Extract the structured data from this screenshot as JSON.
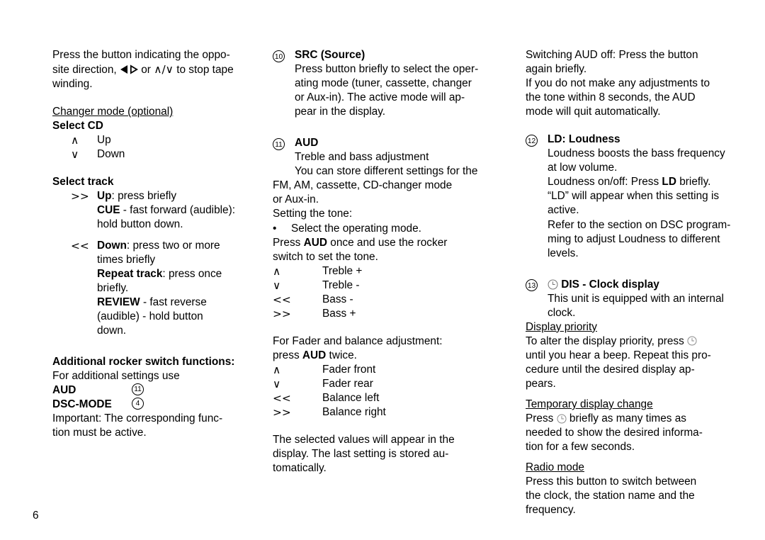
{
  "page": {
    "number": "6",
    "colors": {
      "text": "#000000",
      "background": "#ffffff"
    }
  },
  "icons": {
    "rocker_left_right": "rocker-left-right-icon",
    "arrow_up": "∧",
    "arrow_down": "∨",
    "arrow_back": "<<",
    "arrow_forward": ">>",
    "slash": "/",
    "clock": "clock-icon"
  },
  "left_column": {
    "intro": {
      "part1": "Press the button indicating the oppo-",
      "part2": "site direction, ",
      "part3": " or ",
      "part4": " to stop tape",
      "part5": "winding."
    },
    "changer_heading": "Changer mode (optional)",
    "select_cd": {
      "title": "Select CD",
      "rows": [
        {
          "key": "∧",
          "desc": "Up"
        },
        {
          "key": "∨",
          "desc": "Down"
        }
      ]
    },
    "select_track": {
      "title": "Select track",
      "row1": {
        "key": ">>",
        "line1_bold": "Up",
        "line1_rest": ": press briefly",
        "line2_bold": "CUE",
        "line2_rest": " - fast forward (audible):",
        "line3": "hold button down."
      },
      "row2": {
        "key": "<<",
        "line1_bold": "Down",
        "line1_rest": ": press two or more",
        "line2": "times briefly",
        "line3_bold": "Repeat track",
        "line3_rest": ": press once",
        "line4": "briefly.",
        "line5_bold": "REVIEW",
        "line5_rest": " - fast reverse",
        "line6": "(audible) - hold button",
        "line7": "down."
      }
    },
    "additional": {
      "title": "Additional rocker switch functions:",
      "intro": "For additional settings use",
      "items": [
        {
          "label": "AUD",
          "ref": "11"
        },
        {
          "label": "DSC-MODE",
          "ref": "4"
        }
      ],
      "note_line1": "Important:  The corresponding func-",
      "note_line2": "tion must be active."
    }
  },
  "middle_column": {
    "src": {
      "num": "10",
      "title": "SRC (Source)",
      "body_line1": "Press button briefly to select the oper-",
      "body_line2": "ating mode (tuner, cassette, changer",
      "body_line3": "or Aux-in). The active mode will ap-",
      "body_line4": "pear in the display."
    },
    "aud": {
      "num": "11",
      "title": "AUD",
      "line1": "Treble and bass adjustment",
      "line2": "You can store different settings for the",
      "line3": "FM, AM, cassette, CD-changer mode",
      "line4": "or Aux-in.",
      "line5": "Setting the tone:",
      "bullet": "•",
      "bullet_text": "Select the operating mode.",
      "press_prefix": "Press ",
      "press_bold": "AUD",
      "press_suffix": " once and use the rocker",
      "press_line2": "switch to set the tone.",
      "tone_rows": [
        {
          "key": "∧",
          "desc": "Treble +"
        },
        {
          "key": "∨",
          "desc": "Treble -"
        },
        {
          "key": "<<",
          "desc": "Bass -"
        },
        {
          "key": ">>",
          "desc": "Bass +"
        }
      ],
      "fader_intro": "For Fader and balance adjustment:",
      "fader_press_prefix": "press ",
      "fader_press_bold": "AUD",
      "fader_press_suffix": " twice.",
      "fader_rows": [
        {
          "key": "∧",
          "desc": "Fader front"
        },
        {
          "key": "∨",
          "desc": "Fader rear"
        },
        {
          "key": "<<",
          "desc": "Balance left"
        },
        {
          "key": ">>",
          "desc": "Balance right"
        }
      ],
      "closing_line1": "The selected values will appear in the",
      "closing_line2": "display. The last setting is stored au-",
      "closing_line3": "tomatically."
    }
  },
  "right_column": {
    "aud_off": {
      "line1": "Switching AUD off: Press the button",
      "line2": "again briefly.",
      "line3": "If you do not make any adjustments to",
      "line4": "the tone within 8 seconds, the AUD",
      "line5": "mode will quit automatically."
    },
    "loudness": {
      "num": "12",
      "title": "LD: Loudness",
      "line1": "Loudness boosts the bass frequency",
      "line2": "at low volume.",
      "line3_prefix": "Loudness on/off: Press ",
      "line3_bold": "LD",
      "line3_suffix": " briefly.",
      "line4": "“LD” will appear when this setting is",
      "line5": "active.",
      "line6": "Refer to the section on DSC program-",
      "line7": "ming to adjust Loudness to different",
      "line8": "levels."
    },
    "dis": {
      "num": "13",
      "title": "DIS - Clock display",
      "intro_line1": "This unit is equipped with an internal",
      "intro_line2": "clock.",
      "display_priority": {
        "heading": "Display priority",
        "line1_prefix": "To alter the display priority, press ",
        "line2": "until you hear a beep. Repeat this pro-",
        "line3": "cedure until the desired display ap-",
        "line4": "pears."
      },
      "temporary": {
        "heading": "Temporary display change",
        "line1_prefix": "Press ",
        "line1_suffix": " briefly as many times as",
        "line2": "needed to show the desired informa-",
        "line3": "tion for a few seconds."
      },
      "radio": {
        "heading": "Radio mode",
        "line1": "Press this button to switch between",
        "line2": "the clock, the station name and the",
        "line3": "frequency."
      }
    }
  }
}
